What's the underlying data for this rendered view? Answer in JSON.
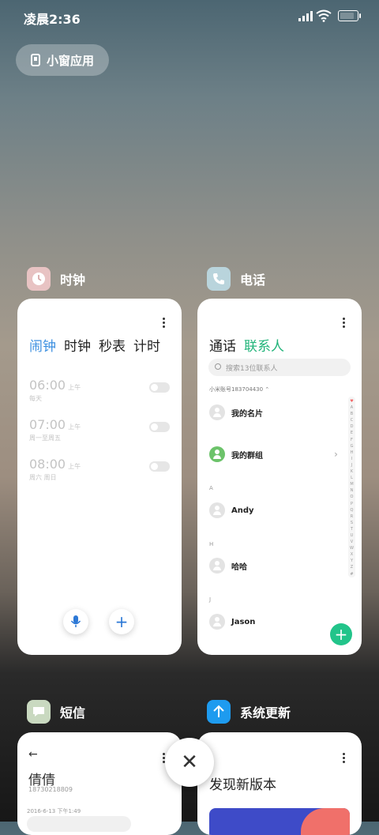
{
  "status": {
    "time": "凌晨2:36"
  },
  "floating_window": {
    "label": "小窗应用"
  },
  "apps": {
    "clock": {
      "name": "时钟",
      "tabs": [
        "闹钟",
        "时钟",
        "秒表",
        "计时"
      ],
      "alarms": [
        {
          "time": "06:00",
          "ampm": "上午",
          "repeat": "每天"
        },
        {
          "time": "07:00",
          "ampm": "上午",
          "repeat": "周一至周五"
        },
        {
          "time": "08:00",
          "ampm": "上午",
          "repeat": "周六 周日"
        }
      ]
    },
    "phone": {
      "name": "电话",
      "tabs": [
        "通话",
        "联系人"
      ],
      "search_placeholder": "搜索13位联系人",
      "account": "小米账号183704430",
      "contacts": {
        "my_card": "我的名片",
        "my_groups": "我的群组",
        "sections": [
          {
            "letter": "A",
            "name": "Andy"
          },
          {
            "letter": "H",
            "name": "哈哈"
          },
          {
            "letter": "J",
            "name": "Jason"
          }
        ]
      },
      "alphabet": [
        "♥",
        "A",
        "B",
        "C",
        "D",
        "E",
        "F",
        "G",
        "H",
        "I",
        "J",
        "K",
        "L",
        "M",
        "N",
        "O",
        "P",
        "Q",
        "R",
        "S",
        "T",
        "U",
        "V",
        "W",
        "X",
        "Y",
        "Z",
        "#"
      ]
    },
    "sms": {
      "name": "短信",
      "contact_name": "倩倩",
      "number": "18730218809",
      "date": "2016-6-13 下午1:49"
    },
    "update": {
      "name": "系统更新",
      "headline": "发现新版本"
    }
  },
  "colors": {
    "clock_accent": "#3b8fe0",
    "phone_accent": "#22b47a",
    "update_icon": "#1e9bef"
  }
}
